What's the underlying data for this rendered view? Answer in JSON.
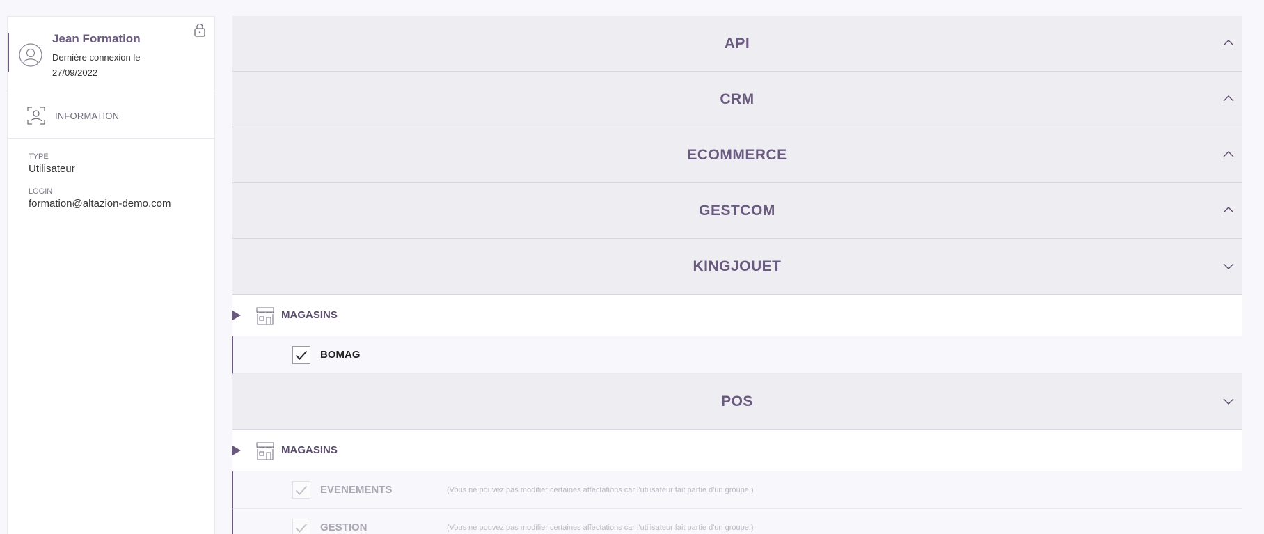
{
  "user": {
    "name": "Jean Formation",
    "last_login": "Dernière connexion le 27/09/2022"
  },
  "sidebar": {
    "nav": [
      {
        "label": "INFORMATION",
        "icon": "user-card-icon"
      }
    ],
    "fields": [
      {
        "label": "TYPE",
        "value": "Utilisateur"
      },
      {
        "label": "LOGIN",
        "value": "formation@altazion-demo.com"
      }
    ]
  },
  "sections": [
    {
      "title": "API",
      "state": "collapsed",
      "chevron": "chevron-up-icon"
    },
    {
      "title": "CRM",
      "state": "collapsed",
      "chevron": "chevron-up-icon"
    },
    {
      "title": "ECOMMERCE",
      "state": "collapsed",
      "chevron": "chevron-up-icon"
    },
    {
      "title": "GESTCOM",
      "state": "collapsed",
      "chevron": "chevron-up-icon"
    },
    {
      "title": "KINGJOUET",
      "state": "expanded",
      "chevron": "chevron-down-icon",
      "group": {
        "label": "MAGASINS",
        "items": [
          {
            "label": "BOMAG",
            "checked": true,
            "disabled": false,
            "note": ""
          }
        ]
      }
    },
    {
      "title": "POS",
      "state": "expanded",
      "chevron": "chevron-down-icon",
      "group": {
        "label": "MAGASINS",
        "items": [
          {
            "label": "EVENEMENTS",
            "checked": true,
            "disabled": true,
            "note": "(Vous ne pouvez pas modifier certaines affectations car l'utilisateur fait partie d'un groupe.)"
          },
          {
            "label": "GESTION",
            "checked": true,
            "disabled": true,
            "note": "(Vous ne pouvez pas modifier certaines affectations car l'utilisateur fait partie d'un groupe.)"
          }
        ]
      }
    }
  ],
  "colors": {
    "accent": "#6a5a80",
    "header_bg": "#eeedf2",
    "page_bg": "#f8f7fb"
  }
}
